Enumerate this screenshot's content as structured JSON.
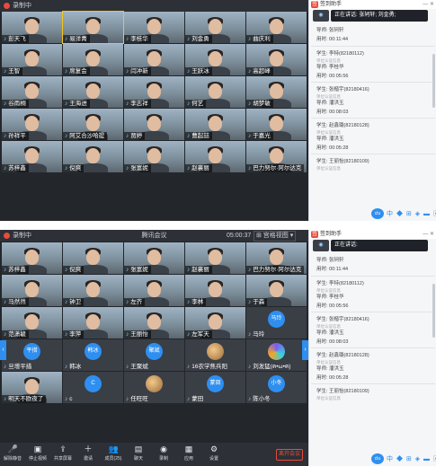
{
  "top_screenshot": {
    "titlebar": {
      "recording_label": "录制中",
      "app_title": "",
      "timer": "",
      "layout_label": "",
      "window_controls": "— ▢ ✕"
    },
    "tiles": [
      {
        "name": "彭天飞",
        "style": "video"
      },
      {
        "name": "易洋菁",
        "style": "video",
        "highlight": true
      },
      {
        "name": "李桂华",
        "style": "video"
      },
      {
        "name": "刘金勇",
        "style": "video"
      },
      {
        "name": "曲庆利",
        "style": "video"
      },
      {
        "name": "王智",
        "style": "video"
      },
      {
        "name": "席复会",
        "style": "video"
      },
      {
        "name": "闫冲新",
        "style": "video"
      },
      {
        "name": "王跃冰",
        "style": "video"
      },
      {
        "name": "高超峰",
        "style": "video"
      },
      {
        "name": "谷雨桐",
        "style": "video"
      },
      {
        "name": "王海进",
        "style": "video"
      },
      {
        "name": "李志祥",
        "style": "video"
      },
      {
        "name": "何艺",
        "style": "video"
      },
      {
        "name": "胡梦敏",
        "style": "video"
      },
      {
        "name": "孙祥平",
        "style": "video"
      },
      {
        "name": "阿艾合沙哈提",
        "style": "video"
      },
      {
        "name": "贾婷",
        "style": "video"
      },
      {
        "name": "曹起喆",
        "style": "video"
      },
      {
        "name": "于嘉光",
        "style": "video"
      },
      {
        "name": "苏梓鑫",
        "style": "video"
      },
      {
        "name": "倪爽",
        "style": "video"
      },
      {
        "name": "张富妮",
        "style": "video"
      },
      {
        "name": "赵襄丽",
        "style": "video"
      },
      {
        "name": "巴力努尔·阿尔达克",
        "style": "video"
      }
    ],
    "panel": {
      "title": "签到助手",
      "controls": "— ✕",
      "speaking": "正在讲话: 张轲轩; 刘金勇;",
      "records": [
        {
          "line1": "导师: 张轲轩",
          "sub": "",
          "time": "用时: 00:11:44"
        },
        {
          "line1": "学生: 李特(82180112)",
          "sub": "单位认证信息",
          "line2": "导师: 李桂华",
          "time": "用时: 00:05:56"
        },
        {
          "line1": "学生: 张楷宇(82180416)",
          "sub": "单位认证信息",
          "line2": "导师: 潘洪玉",
          "time": "用时: 00:08:03"
        },
        {
          "line1": "学生: 赵鑫璐(82180128)",
          "sub": "单位认证信息",
          "line2": "导师: 潘洪玉",
          "time": "用时: 00:05:28"
        },
        {
          "line1": "学生: 王丽怡(82180109)",
          "sub": "单位认证信息",
          "line2": "",
          "time": ""
        }
      ],
      "footer_logo": "clu",
      "footer_icons": "中 ◆ ⊞ ◈ ▬ ▣"
    }
  },
  "bottom_screenshot": {
    "titlebar": {
      "recording_label": "录制中",
      "app_title": "腾讯会议",
      "timer": "05:00:37",
      "layout_label": "⊞ 宫格视图 ▾",
      "window_controls": "— ▢ ✕"
    },
    "tiles": [
      {
        "name": "苏梓鑫",
        "style": "video"
      },
      {
        "name": "倪爽",
        "style": "video"
      },
      {
        "name": "张富妮",
        "style": "video"
      },
      {
        "name": "赵襄丽",
        "style": "video"
      },
      {
        "name": "巴力努尔·阿尔达克",
        "style": "video"
      },
      {
        "name": "马然然",
        "style": "video"
      },
      {
        "name": "钟卫",
        "style": "video"
      },
      {
        "name": "左齐",
        "style": "video"
      },
      {
        "name": "李林",
        "style": "video"
      },
      {
        "name": "于森",
        "style": "video"
      },
      {
        "name": "范潇毓",
        "style": "video"
      },
      {
        "name": "李萍",
        "style": "video"
      },
      {
        "name": "王丽怡",
        "style": "video"
      },
      {
        "name": "左军天",
        "style": "video"
      },
      {
        "name": "马玲",
        "style": "avatar",
        "avatar": "马玲"
      },
      {
        "name": "旦增平措",
        "style": "avatar",
        "avatar": "平措"
      },
      {
        "name": "韩冰",
        "style": "avatar",
        "avatar": "韩冰"
      },
      {
        "name": "王聚斌",
        "style": "avatar",
        "avatar": "聚斌"
      },
      {
        "name": "16农学焦兵阳",
        "style": "avatar",
        "avatar": "",
        "avatar_kind": "img"
      },
      {
        "name": "刘发猛(ฅ•ω•ฅ)",
        "style": "avatar",
        "avatar": "",
        "avatar_kind": "purple"
      },
      {
        "name": "明天不欧夜了",
        "style": "video"
      },
      {
        "name": "c",
        "style": "avatar",
        "avatar": "C"
      },
      {
        "name": "任旺旺",
        "style": "avatar",
        "avatar": "",
        "avatar_kind": "img"
      },
      {
        "name": "蒙田",
        "style": "avatar",
        "avatar": "蒙田"
      },
      {
        "name": "陈小冬",
        "style": "avatar",
        "avatar": "小冬"
      }
    ],
    "toolbar": {
      "items": [
        {
          "label": "解除静音",
          "icon": "🎤"
        },
        {
          "label": "停止视频",
          "icon": "▣"
        },
        {
          "label": "共享屏幕",
          "icon": "⇪"
        },
        {
          "label": "邀请",
          "icon": "＋"
        },
        {
          "label": "成员(25)",
          "icon": "👥"
        },
        {
          "label": "聊天",
          "icon": "▤"
        },
        {
          "label": "录制",
          "icon": "◉"
        },
        {
          "label": "应用",
          "icon": "▦"
        },
        {
          "label": "设置",
          "icon": "⚙"
        }
      ],
      "leave_label": "离开会议"
    },
    "panel": {
      "title": "签到助手",
      "controls": "— ✕",
      "speaking": "正在讲话:",
      "records": [
        {
          "line1": "导师: 张轲轩",
          "sub": "",
          "time": "用时: 00:11:44"
        },
        {
          "line1": "学生: 李特(82180112)",
          "sub": "单位认证信息",
          "line2": "导师: 李桂华",
          "time": "用时: 00:05:56"
        },
        {
          "line1": "学生: 张楷宇(82180416)",
          "sub": "单位认证信息",
          "line2": "导师: 潘洪玉",
          "time": "用时: 00:08:03"
        },
        {
          "line1": "学生: 赵鑫璐(82180128)",
          "sub": "单位认证信息",
          "line2": "导师: 潘洪玉",
          "time": "用时: 00:05:28"
        },
        {
          "line1": "学生: 王丽怡(82180109)",
          "sub": "单位认证信息",
          "line2": "",
          "time": ""
        }
      ],
      "footer_logo": "clu",
      "footer_icons": "中 ◆ ⊞ ◈ ▬ ▣"
    }
  },
  "colors": {
    "accent": "#2f8ff0",
    "recording": "#e84b3c",
    "meeting_bg": "#23262b",
    "panel_bg": "#f5f6f8"
  }
}
